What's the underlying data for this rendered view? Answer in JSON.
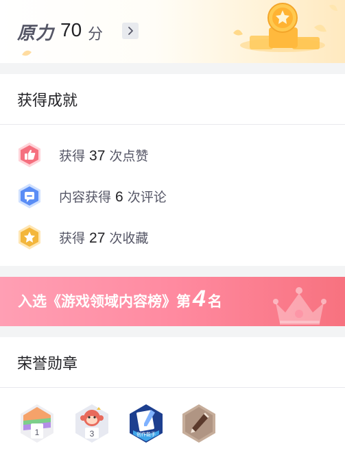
{
  "force": {
    "label": "原力",
    "score": "70",
    "unit": "分"
  },
  "achievements": {
    "title": "获得成就",
    "items": [
      {
        "prefix": "获得",
        "count": "37",
        "suffix": "次点赞",
        "icon": "thumbs-up-icon",
        "color": "#f5707f"
      },
      {
        "prefix": "内容获得",
        "count": "6",
        "suffix": "次评论",
        "icon": "comment-icon",
        "color": "#5a8df5"
      },
      {
        "prefix": "获得",
        "count": "27",
        "suffix": "次收藏",
        "icon": "star-icon",
        "color": "#f3b63c"
      }
    ]
  },
  "banner": {
    "prefix": "入选《游戏领域内容榜》第",
    "rank": "4",
    "suffix": "名"
  },
  "honor": {
    "title": "荣誉勋章",
    "badges": [
      {
        "icon": "checkin-badge-icon",
        "caption": "1"
      },
      {
        "icon": "monkey-badge-icon",
        "caption": "3"
      },
      {
        "icon": "creator-badge-icon",
        "caption": "创作能手"
      },
      {
        "icon": "pen-badge-icon",
        "caption": ""
      }
    ]
  }
}
